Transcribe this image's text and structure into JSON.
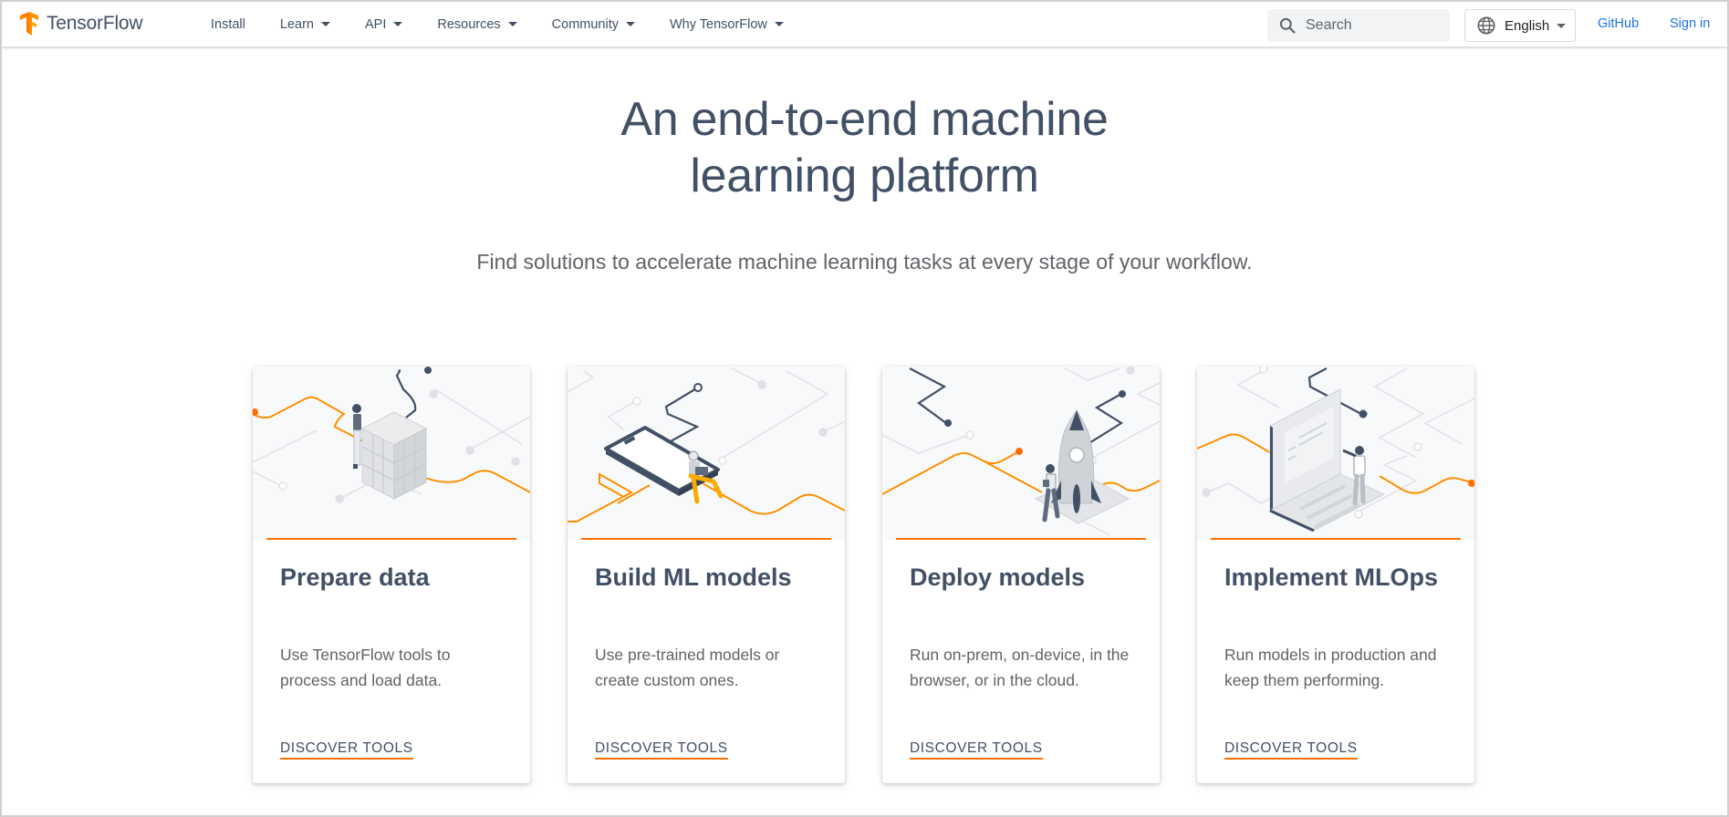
{
  "nav": {
    "brand": "TensorFlow",
    "logo_icon": "tensorflow-logo",
    "links": [
      {
        "label": "Install",
        "dropdown": false
      },
      {
        "label": "Learn",
        "dropdown": true
      },
      {
        "label": "API",
        "dropdown": true
      },
      {
        "label": "Resources",
        "dropdown": true
      },
      {
        "label": "Community",
        "dropdown": true
      },
      {
        "label": "Why TensorFlow",
        "dropdown": true
      }
    ],
    "search": {
      "placeholder": "Search",
      "value": "",
      "icon": "search-icon"
    },
    "language": {
      "selected": "English",
      "icon": "globe-icon"
    },
    "github_label": "GitHub",
    "signin_label": "Sign in",
    "link_color": "#1a73e8"
  },
  "hero": {
    "title_line1": "An end-to-end machine",
    "title_line2": "learning platform",
    "subtitle": "Find solutions to accelerate machine learning tasks at every stage of your workflow."
  },
  "colors": {
    "accent": "#ff6f00",
    "text": "#425066",
    "muted": "#5f6368"
  },
  "cards": [
    {
      "title": "Prepare data",
      "desc": "Use TensorFlow tools to process and load data.",
      "cta": "DISCOVER TOOLS",
      "illustration": "person-with-data-cube"
    },
    {
      "title": "Build ML models",
      "desc": "Use pre-trained models or create custom ones.",
      "cta": "DISCOVER TOOLS",
      "illustration": "person-on-phone"
    },
    {
      "title": "Deploy models",
      "desc": "Run on-prem, on-device, in the browser, or in the cloud.",
      "cta": "DISCOVER TOOLS",
      "illustration": "person-with-rocket"
    },
    {
      "title": "Implement MLOps",
      "desc": "Run models in production and keep them performing.",
      "cta": "DISCOVER TOOLS",
      "illustration": "person-at-laptop"
    }
  ]
}
